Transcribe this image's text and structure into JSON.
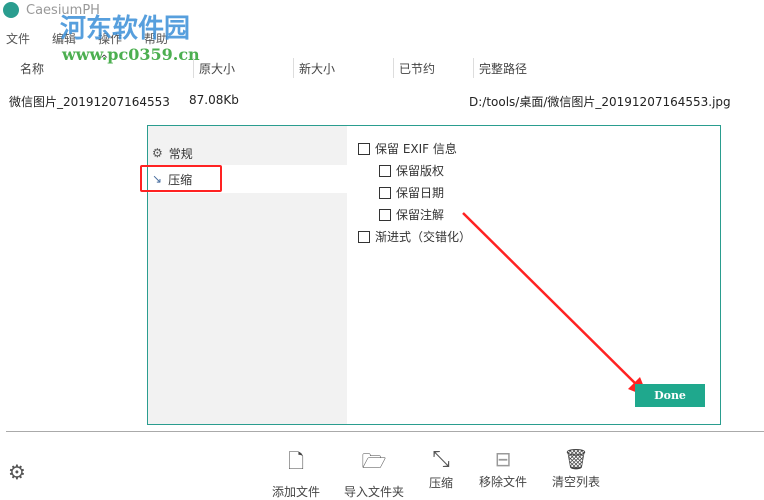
{
  "app": {
    "title": "CaesiumPH"
  },
  "watermark": {
    "name": "河东软件园",
    "url": "www.pc0359.cn"
  },
  "menu": [
    "文件",
    "编辑",
    "操作",
    "帮助"
  ],
  "columns": [
    "名称",
    "原大小",
    "新大小",
    "已节约",
    "完整路径"
  ],
  "rows": [
    {
      "name": "微信图片_20191207164553",
      "orig": "87.08Kb",
      "new": "",
      "saved": "",
      "path": "D:/tools/桌面/微信图片_20191207164553.jpg"
    }
  ],
  "settings": {
    "sidebar": [
      {
        "label": "常规",
        "icon": "gears-icon"
      },
      {
        "label": "压缩",
        "icon": "compress-icon",
        "active": true
      }
    ],
    "options": [
      {
        "label": "保留 EXIF 信息",
        "checked": false
      },
      {
        "label": "保留版权",
        "checked": false
      },
      {
        "label": "保留日期",
        "checked": false
      },
      {
        "label": "保留注解",
        "checked": false
      },
      {
        "label": "渐进式（交错化）",
        "checked": false
      }
    ],
    "done_label": "Done"
  },
  "toolbar": [
    "添加文件",
    "导入文件夹",
    "压缩",
    "移除文件",
    "清空列表"
  ],
  "colors": {
    "accent": "#1fa88d",
    "highlight": "#ff2222"
  }
}
